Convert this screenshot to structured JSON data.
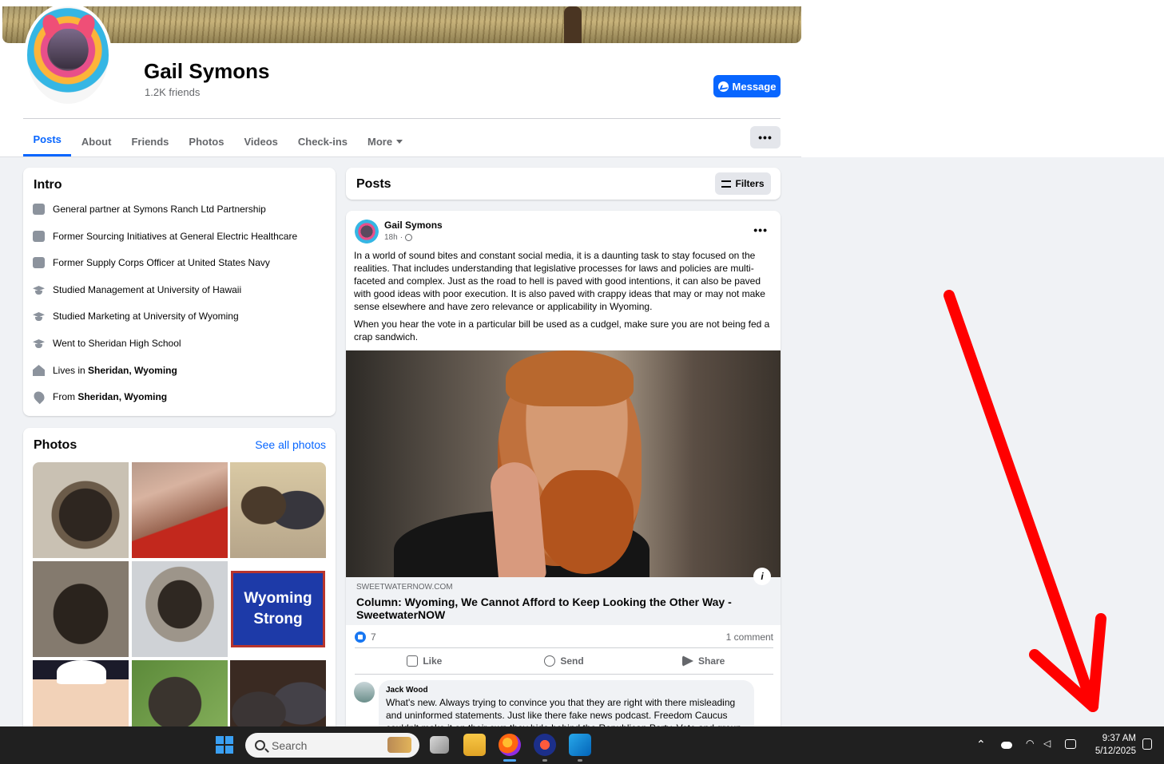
{
  "profile": {
    "name": "Gail Symons",
    "friends": "1.2K friends",
    "message_label": "Message"
  },
  "tabs": [
    {
      "label": "Posts",
      "active": true
    },
    {
      "label": "About"
    },
    {
      "label": "Friends"
    },
    {
      "label": "Photos"
    },
    {
      "label": "Videos"
    },
    {
      "label": "Check-ins"
    },
    {
      "label": "More"
    }
  ],
  "more_dots": "•••",
  "intro": {
    "title": "Intro",
    "items": [
      {
        "icon": "briefcase-icon",
        "text": "General partner at Symons Ranch Ltd Partnership"
      },
      {
        "icon": "briefcase-icon",
        "text": "Former Sourcing Initiatives at General Electric Healthcare"
      },
      {
        "icon": "briefcase-icon",
        "text": "Former Supply Corps Officer at United States Navy"
      },
      {
        "icon": "graduation-cap-icon",
        "text": "Studied Management at University of Hawaii"
      },
      {
        "icon": "graduation-cap-icon",
        "text": "Studied Marketing at University of Wyoming"
      },
      {
        "icon": "graduation-cap-icon",
        "text": "Went to Sheridan High School"
      },
      {
        "icon": "home-icon",
        "prefix": "Lives in ",
        "bold": "Sheridan, Wyoming"
      },
      {
        "icon": "location-pin-icon",
        "prefix": "From ",
        "bold": "Sheridan, Wyoming"
      }
    ]
  },
  "photos": {
    "title": "Photos",
    "see_all": "See all photos",
    "sign_line1": "Wyoming",
    "sign_line2": "Strong"
  },
  "posts_header": {
    "title": "Posts",
    "filters_label": "Filters"
  },
  "post": {
    "author": "Gail Symons",
    "time": "18h",
    "more": "•••",
    "paragraph1": "In a world of sound bites and constant social media, it is a daunting task to stay focused on the realities.  That includes understanding that legislative processes for laws and policies are multi-faceted and complex.  Just as the road to hell is paved with good intentions, it can also be paved with good ideas with poor execution.  It is also paved with crappy ideas that may or may not make sense elsewhere and have zero relevance or applicability in Wyoming.",
    "paragraph2": "When  you hear the vote in a particular bill be used as a cudgel, make sure you are not being fed a crap sandwich.",
    "link_domain": "SWEETWATERNOW.COM",
    "link_title": "Column: Wyoming, We Cannot Afford to Keep Looking the Other Way - SweetwaterNOW",
    "info_icon": "i",
    "reaction_count": "7",
    "comment_count": "1 comment",
    "actions": {
      "like": "Like",
      "send": "Send",
      "share": "Share"
    }
  },
  "comment": {
    "author": "Jack Wood",
    "text": "What's new. Always trying to convince you that they are right with there misleading and uninformed statements. Just like there fake news podcast. Freedom Caucus couldn't make it on their own they hide behind the Republican Party. Vote and group"
  },
  "taskbar": {
    "search_placeholder": "Search",
    "time": "9:37 AM",
    "date": "5/12/2025"
  },
  "colors": {
    "accent": "#0866ff",
    "annotation_arrow": "#ff0000",
    "taskbar": "#202020"
  }
}
